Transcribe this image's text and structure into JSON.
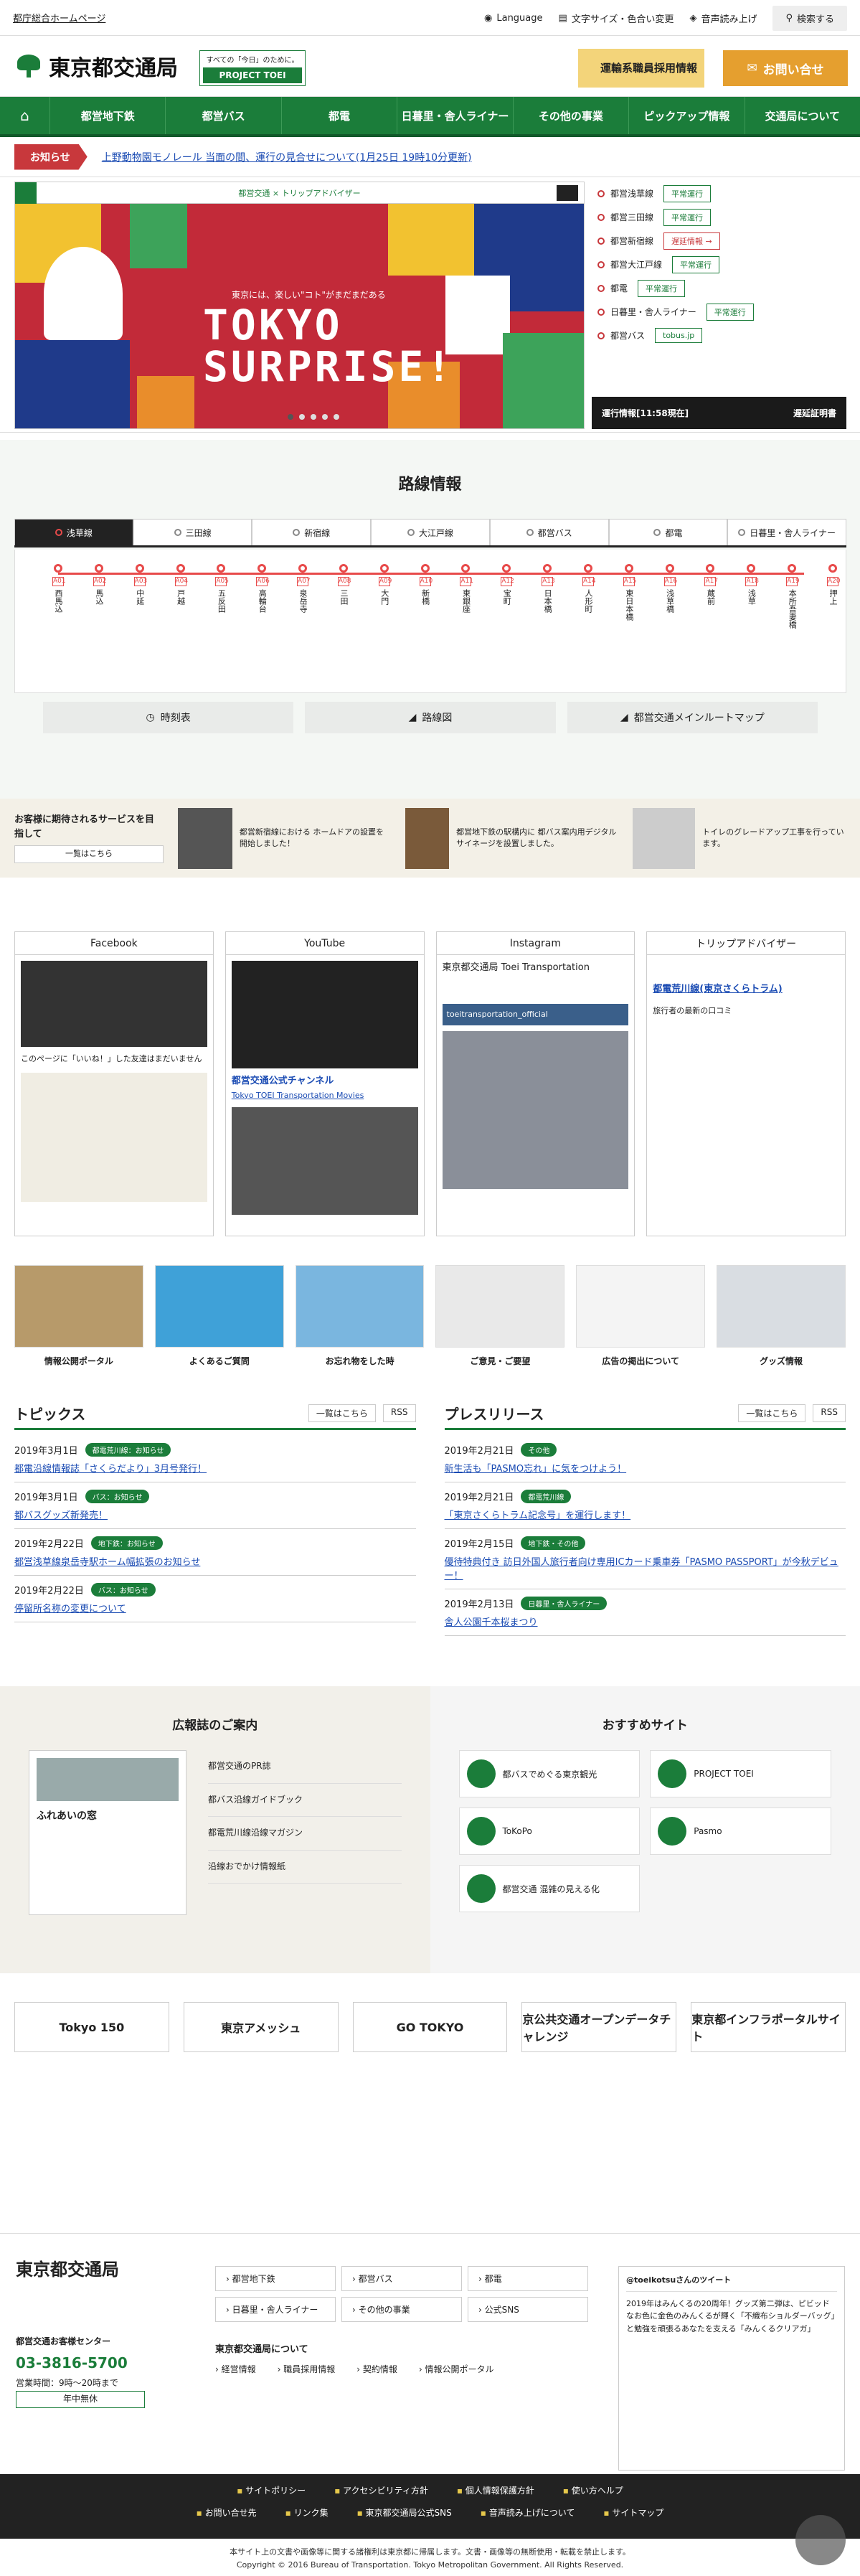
{
  "utility": {
    "gov_link": "都庁総合ホームページ",
    "language": "Language",
    "text_size": "文字サイズ・色合い変更",
    "speech": "音声読み上げ",
    "search": "検索する"
  },
  "header": {
    "site_name": "東京都交通局",
    "project_tagline": "すべての「今日」のために。",
    "project_name": "PROJECT TOEI",
    "recruit": "運輸系職員採用情報",
    "contact": "お問い合せ"
  },
  "gnav": {
    "items": [
      "都営地下鉄",
      "都営バス",
      "都電",
      "日暮里・舎人ライナー",
      "その他の事業",
      "ピックアップ情報",
      "交通局について"
    ]
  },
  "notice": {
    "label": "お知らせ",
    "message": "上野動物園モノレール 当面の間、運行の見合せについて(1月25日 19時10分更新)"
  },
  "hero": {
    "slider_header": "都営交通 × トリップアドバイザー",
    "slider_sub": "東京には、楽しい\"コト\"がまだまだある",
    "slider_title_1": "TOKYO",
    "slider_title_2": "SURPRISE!"
  },
  "status": {
    "rows": [
      {
        "line": "都営浅草線",
        "state": "平常運行"
      },
      {
        "line": "都営三田線",
        "state": "平常運行"
      },
      {
        "line": "都営新宿線",
        "state": "遅延情報 →"
      },
      {
        "line": "都営大江戸線",
        "state": "平常運行"
      },
      {
        "line": "都電",
        "state": "平常運行"
      },
      {
        "line": "日暮里・舎人ライナー",
        "state": "平常運行"
      },
      {
        "line": "都営バス",
        "state": "tobus.jp"
      }
    ],
    "time_label": "運行情報[11:58現在]",
    "delay_label": "遅延証明書"
  },
  "route": {
    "title": "路線情報",
    "tabs": [
      "浅草線",
      "三田線",
      "新宿線",
      "大江戸線",
      "都営バス",
      "都電",
      "日暮里・舎人ライナー"
    ],
    "stations": [
      {
        "code": "A01",
        "name": "西馬込"
      },
      {
        "code": "A02",
        "name": "馬込"
      },
      {
        "code": "A03",
        "name": "中延"
      },
      {
        "code": "A04",
        "name": "戸越"
      },
      {
        "code": "A05",
        "name": "五反田"
      },
      {
        "code": "A06",
        "name": "高輪台"
      },
      {
        "code": "A07",
        "name": "泉岳寺"
      },
      {
        "code": "A08",
        "name": "三田"
      },
      {
        "code": "A09",
        "name": "大門"
      },
      {
        "code": "A10",
        "name": "新橋"
      },
      {
        "code": "A11",
        "name": "東銀座"
      },
      {
        "code": "A12",
        "name": "宝町"
      },
      {
        "code": "A13",
        "name": "日本橋"
      },
      {
        "code": "A14",
        "name": "人形町"
      },
      {
        "code": "A15",
        "name": "東日本橋"
      },
      {
        "code": "A16",
        "name": "浅草橋"
      },
      {
        "code": "A17",
        "name": "蔵前"
      },
      {
        "code": "A18",
        "name": "浅草"
      },
      {
        "code": "A19",
        "name": "本所吾妻橋"
      },
      {
        "code": "A20",
        "name": "押上"
      }
    ],
    "buttons": [
      "時刻表",
      "路線図",
      "都営交通メインルートマップ"
    ]
  },
  "service": {
    "lead": "お客様に期待されるサービスを目指して",
    "more": "一覧はこちら",
    "cards": [
      "都営新宿線における ホームドアの設置を開始しました！",
      "都営地下鉄の駅構内に 都バス案内用デジタル サイネージを設置しました。",
      "トイレのグレードアップ工事を行っています。"
    ]
  },
  "sns": {
    "boxes": [
      {
        "title": "Facebook",
        "text": "このページに「いいね！」した友達はまだいません"
      },
      {
        "title": "YouTube",
        "text": "都営交通公式チャンネル",
        "text2": "Tokyo TOEI Transportation Movies"
      },
      {
        "title": "Instagram",
        "text": "東京都交通局 Toei Transportation",
        "text2": "toeitransportation_official"
      },
      {
        "title": "トリップアドバイザー",
        "text": "都電荒川線(東京さくらトラム)",
        "text2": "旅行者の最新の口コミ"
      }
    ]
  },
  "tiles": [
    "情報公開ポータル",
    "よくあるご質問",
    "お忘れ物をした時",
    "ご意見・ご要望",
    "広告の掲出について",
    "グッズ情報"
  ],
  "topics": {
    "title": "トピックス",
    "more": "一覧はこちら",
    "rss": "RSS",
    "items": [
      {
        "date": "2019年3月1日",
        "cat": "都電荒川線：お知らせ",
        "title": "都電沿線情報誌「さくらだより」3月号発行！"
      },
      {
        "date": "2019年3月1日",
        "cat": "バス：お知らせ",
        "title": "都バスグッズ新発売！"
      },
      {
        "date": "2019年2月22日",
        "cat": "地下鉄：お知らせ",
        "title": "都営浅草線泉岳寺駅ホーム幅拡張のお知らせ"
      },
      {
        "date": "2019年2月22日",
        "cat": "バス：お知らせ",
        "title": "停留所名称の変更について"
      }
    ]
  },
  "press": {
    "title": "プレスリリース",
    "more": "一覧はこちら",
    "rss": "RSS",
    "items": [
      {
        "date": "2019年2月21日",
        "cat": "その他",
        "title": "新生活も「PASMO忘れ」に気をつけよう！"
      },
      {
        "date": "2019年2月21日",
        "cat": "都電荒川線",
        "title": "「東京さくらトラム記念号」を運行します！"
      },
      {
        "date": "2019年2月15日",
        "cat": "地下鉄・その他",
        "title": "優待特典付き 訪日外国人旅行者向け専用ICカード乗車券「PASMO PASSPORT」が今秋デビュー！"
      },
      {
        "date": "2019年2月13日",
        "cat": "日暮里・舎人ライナー",
        "title": "舎人公園千本桜まつり"
      }
    ]
  },
  "magazine": {
    "title": "広報誌のご案内",
    "cover_title": "ふれあいの窓",
    "items": [
      "都営交通のPR誌",
      "都バス沿線ガイドブック",
      "都電荒川線沿線マガジン",
      "沿線おでかけ情報紙"
    ]
  },
  "recommend": {
    "title": "おすすめサイト",
    "items": [
      "都バスでめぐる東京観光",
      "PROJECT TOEI",
      "ToKoPo",
      "Pasmo",
      "都営交通 混雑の見える化"
    ]
  },
  "banners": [
    "Tokyo 150",
    "東京アメッシュ",
    "GO TOKYO",
    "京公共交通オープンデータチャレンジ",
    "東京都インフラポータルサイト"
  ],
  "footer": {
    "site_name": "東京都交通局",
    "cs_label": "都営交通お客様センター",
    "cs_tel": "03-3816-5700",
    "cs_hours": "営業時間：9時〜20時まで",
    "cs_days": "年中無休",
    "links": [
      "都営地下鉄",
      "都営バス",
      "都電",
      "日暮里・舎人ライナー",
      "その他の事業",
      "公式SNS"
    ],
    "about": "東京都交通局について",
    "about_links": [
      "経営情報",
      "職員採用情報",
      "契約情報",
      "情報公開ポータル"
    ],
    "tweet_label": "@toeikotsuさんのツイート",
    "tweet_text": "2019年はみんくるの20周年！グッズ第二弾は、ピビッドなお色に金色のみんくるが輝く「不織布ショルダーバッグ」と勉強を頑張るあなたを支える「みんくるクリアガ」",
    "bottom_links": [
      "サイトポリシー",
      "アクセシビリティ方針",
      "個人情報保護方針",
      "使い方ヘルプ",
      "お問い合せ先",
      "リンク集",
      "東京都交通局公式SNS",
      "音声読み上げについて",
      "サイトマップ"
    ],
    "copyright_1": "本サイト上の文書や画像等に関する諸権利は東京都に帰属します。文書・画像等の無断使用・転載を禁止します。",
    "copyright_2": "Copyright © 2016 Bureau of Transportation. Tokyo Metropolitan Government. All Rights Reserved."
  },
  "colors": {
    "brand": "#1b7d3a",
    "alert": "#c8383c",
    "asakusa": "#e84a4a"
  }
}
